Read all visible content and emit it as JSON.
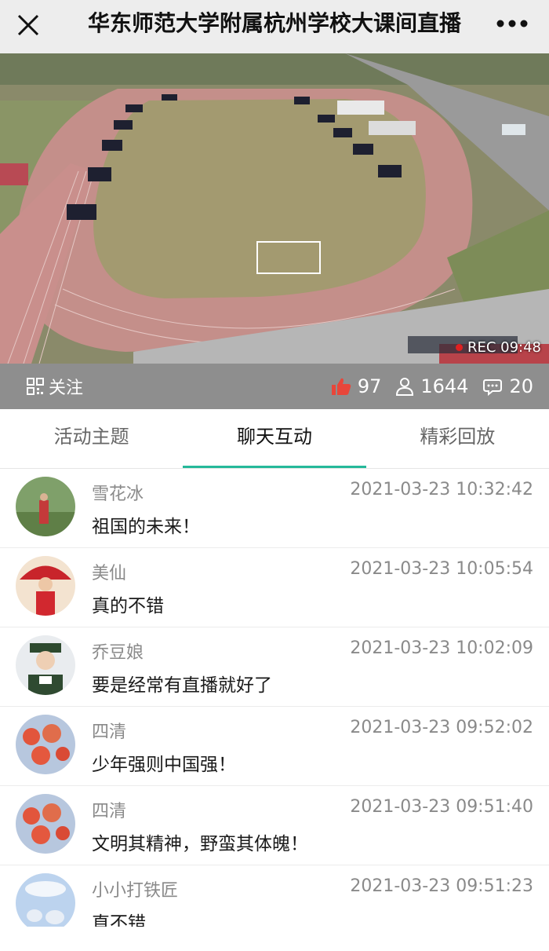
{
  "header": {
    "title": "华东师范大学附属杭州学校大课间直播",
    "close_icon": "close-icon",
    "more_icon": "more-dots-icon"
  },
  "video": {
    "rec_label": "REC 09:48"
  },
  "statbar": {
    "follow_label": "关注",
    "likes": "97",
    "viewers": "1644",
    "comments": "20",
    "colors": {
      "like": "#e8463a",
      "bar_bg": "#8e8e8e"
    }
  },
  "tabs": [
    {
      "label": "活动主题"
    },
    {
      "label": "聊天互动"
    },
    {
      "label": "精彩回放"
    }
  ],
  "accent": "#25b99a",
  "messages": [
    {
      "user": "雪花冰",
      "time": "2021-03-23 10:32:42",
      "text": "祖国的未来！"
    },
    {
      "user": "美仙",
      "time": "2021-03-23 10:05:54",
      "text": "真的不错"
    },
    {
      "user": "乔豆娘",
      "time": "2021-03-23 10:02:09",
      "text": "要是经常有直播就好了"
    },
    {
      "user": "四清",
      "time": "2021-03-23 09:52:02",
      "text": "少年强则中国强！"
    },
    {
      "user": "四清",
      "time": "2021-03-23 09:51:40",
      "text": "文明其精神，野蛮其体魄！"
    },
    {
      "user": "小小打铁匠",
      "time": "2021-03-23 09:51:23",
      "text": "直不错"
    }
  ]
}
